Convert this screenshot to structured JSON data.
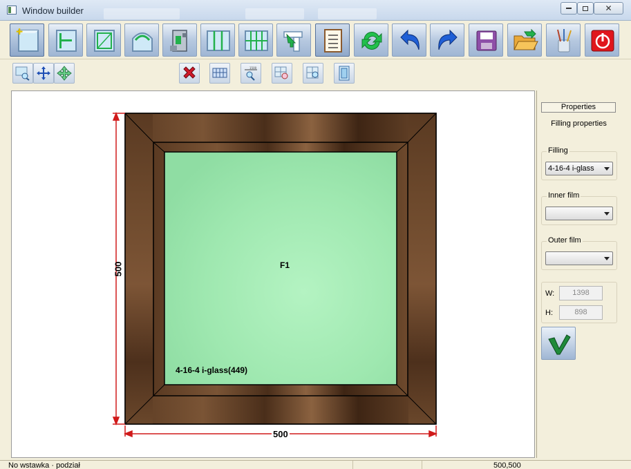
{
  "window": {
    "title": "Window builder",
    "controls": {
      "minimize": "▭",
      "restore": "▣",
      "close": "✕"
    }
  },
  "toolbar_main": {
    "buttons": [
      {
        "icon": "new-window-icon",
        "active": true
      },
      {
        "icon": "mullion-icon"
      },
      {
        "icon": "sash-icon"
      },
      {
        "icon": "arch-icon"
      },
      {
        "icon": "profile-icon"
      },
      {
        "icon": "sliding-window-icon"
      },
      {
        "icon": "grid-window-icon"
      },
      {
        "icon": "pointer-icon"
      },
      {
        "icon": "checklist-icon",
        "active": true
      },
      {
        "icon": "refresh-icon"
      },
      {
        "icon": "undo-icon"
      },
      {
        "icon": "redo-icon"
      },
      {
        "icon": "save-icon"
      },
      {
        "icon": "open-folder-icon"
      },
      {
        "icon": "brushes-icon"
      },
      {
        "icon": "power-icon"
      }
    ]
  },
  "toolbar_sub": {
    "buttons": [
      {
        "icon": "zoom-window-icon"
      },
      {
        "icon": "move-icon"
      },
      {
        "icon": "expand-icon"
      },
      {
        "icon": "delete-icon"
      },
      {
        "icon": "grid-icon"
      },
      {
        "icon": "dimension-zoom-icon"
      },
      {
        "icon": "glass-zoom-icon"
      },
      {
        "icon": "glass-zoom-2-icon"
      },
      {
        "icon": "door-icon"
      }
    ]
  },
  "drawing": {
    "height_dim": "500",
    "width_dim": "500",
    "fill_name": "F1",
    "fill_spec": "4-16-4 i-glass(449)",
    "colors": {
      "glass": "#9fe8b0",
      "frame": "#6a4a2e",
      "dimension": "#d01a1a"
    }
  },
  "properties": {
    "tab": "Properties",
    "subtitle": "Filling properties",
    "filling": {
      "label": "Filling",
      "value": "4-16-4 i-glass"
    },
    "inner_film": {
      "label": "Inner film",
      "value": ""
    },
    "outer_film": {
      "label": "Outer film",
      "value": ""
    },
    "width": {
      "label": "W:",
      "value": "1398"
    },
    "height": {
      "label": "H:",
      "value": "898"
    }
  },
  "statusbar": {
    "left": "No wstawka · podział",
    "right": "500,500"
  }
}
